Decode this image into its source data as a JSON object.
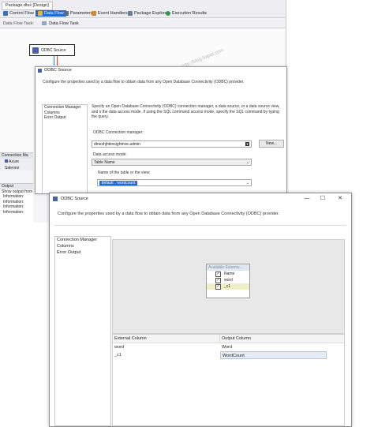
{
  "vs": {
    "doc_tab": "Package.dtsx [Design]",
    "toolbar": [
      {
        "label": "Control Flow",
        "color": "#3b6fc4",
        "selected": false
      },
      {
        "label": "Data Flow",
        "color": "#e8b33a",
        "selected": true
      },
      {
        "label": "Parameters",
        "color": "#5d6b7e",
        "selected": false
      },
      {
        "label": "Event Handlers",
        "color": "#d18a2a",
        "selected": false
      },
      {
        "label": "Package Explorer",
        "color": "#6a7f9b",
        "selected": false
      },
      {
        "label": "Execution Results",
        "color": "#2e9c4f",
        "selected": false
      }
    ],
    "subtoolbar": {
      "label": "Data Flow Task:",
      "task": "Data Flow Task"
    },
    "component": "ODBC Source",
    "connection_managers": {
      "header": "Connection Ma",
      "item": "Azure Saleone"
    },
    "output": {
      "header": "Output",
      "show_from": "Show output from",
      "lines": [
        "Information:",
        "Information:",
        "Information:",
        "Information:"
      ]
    },
    "watermark": "http://blog.bapat.com"
  },
  "dialog1": {
    "title": "ODBC Source",
    "description": "Configure the properties used by a data flow to obtain data from any Open Database Connectivity (ODBC) provider.",
    "nav": [
      "Connection Manager",
      "Columns",
      "Error Output"
    ],
    "instructions": "Specify an Open Database Connectivity (ODBC) connection manager, a data source, or a data source view, and s the data access mode. If using the SQL command access mode, specify the SQL command by typing the query.",
    "conn_label": "ODBC Connection manager:",
    "conn_value": "dineshjhbinsightnve.admin",
    "new_button": "New...",
    "access_label": "Data access mode:",
    "access_value": "Table Name",
    "table_label": "Name of the table or the view:",
    "table_value": "`default`.`wordcount`"
  },
  "dialog2": {
    "title": "ODBC Source",
    "description": "Configure the properties used by a data flow to obtain data from any Open Database Connectivity (ODBC) provider.",
    "nav": [
      "Connection Manager",
      "Columns",
      "Error Output"
    ],
    "external_box": {
      "header": "Available Externa...",
      "rows": [
        {
          "label": "Name",
          "checked": true
        },
        {
          "label": "word",
          "checked": true
        },
        {
          "label": "_c1",
          "checked": true
        }
      ]
    },
    "grid": {
      "headers": [
        "External Column",
        "Output Column"
      ],
      "rows": [
        {
          "external": "word",
          "output": "Word"
        },
        {
          "external": "_c1",
          "output": "WordCount"
        }
      ]
    },
    "window_buttons": [
      "—",
      "☐",
      "✕"
    ]
  }
}
